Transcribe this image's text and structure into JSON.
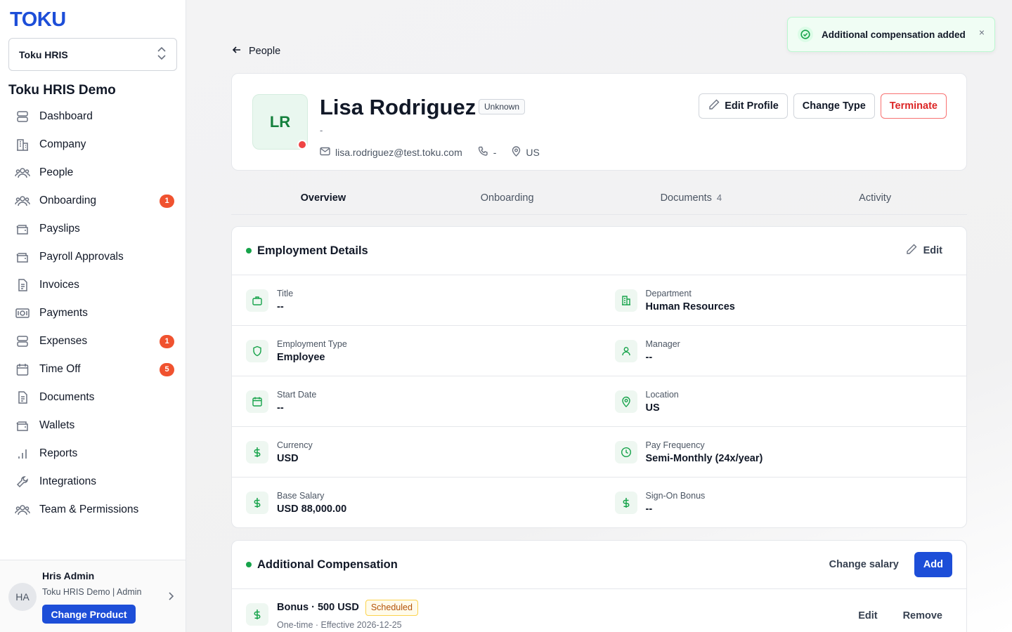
{
  "sidebar": {
    "logo": "TOKU",
    "product_select": "Toku HRIS",
    "org_name": "Toku HRIS Demo",
    "items": [
      {
        "label": "Dashboard",
        "icon": "stack-icon",
        "badge": ""
      },
      {
        "label": "Company",
        "icon": "building-icon",
        "badge": ""
      },
      {
        "label": "People",
        "icon": "users-icon",
        "badge": ""
      },
      {
        "label": "Onboarding",
        "icon": "users-icon",
        "badge": "1"
      },
      {
        "label": "Payslips",
        "icon": "wallet-icon",
        "badge": ""
      },
      {
        "label": "Payroll Approvals",
        "icon": "wallet-icon",
        "badge": ""
      },
      {
        "label": "Invoices",
        "icon": "document-icon",
        "badge": ""
      },
      {
        "label": "Payments",
        "icon": "banknote-icon",
        "badge": ""
      },
      {
        "label": "Expenses",
        "icon": "stack-icon",
        "badge": "1"
      },
      {
        "label": "Time Off",
        "icon": "calendar-icon",
        "badge": "5"
      },
      {
        "label": "Documents",
        "icon": "document-icon",
        "badge": ""
      },
      {
        "label": "Wallets",
        "icon": "wallet-icon",
        "badge": ""
      },
      {
        "label": "Reports",
        "icon": "bar-chart-icon",
        "badge": ""
      },
      {
        "label": "Integrations",
        "icon": "wrench-icon",
        "badge": ""
      },
      {
        "label": "Team & Permissions",
        "icon": "users-icon",
        "badge": ""
      }
    ],
    "user": {
      "initials": "HA",
      "name": "Hris Admin",
      "role": "Toku HRIS Demo | Admin",
      "change_product": "Change Product"
    }
  },
  "breadcrumb": {
    "back_label": "People"
  },
  "profile": {
    "initials": "LR",
    "name": "Lisa Rodriguez",
    "status_badge": "Unknown",
    "subtitle": "-",
    "email": "lisa.rodriguez@test.toku.com",
    "phone": "-",
    "location": "US",
    "buttons": {
      "edit": "Edit Profile",
      "change_type": "Change Type",
      "terminate": "Terminate"
    }
  },
  "tabs": [
    {
      "label": "Overview",
      "count": ""
    },
    {
      "label": "Onboarding",
      "count": ""
    },
    {
      "label": "Documents",
      "count": "4"
    },
    {
      "label": "Activity",
      "count": ""
    }
  ],
  "employment": {
    "title": "Employment Details",
    "edit_label": "Edit",
    "rows": [
      [
        {
          "label": "Title",
          "value": "--",
          "icon": "briefcase-icon"
        },
        {
          "label": "Department",
          "value": "Human Resources",
          "icon": "building-icon"
        }
      ],
      [
        {
          "label": "Employment Type",
          "value": "Employee",
          "icon": "shield-icon"
        },
        {
          "label": "Manager",
          "value": "--",
          "icon": "user-icon"
        }
      ],
      [
        {
          "label": "Start Date",
          "value": "--",
          "icon": "calendar-icon"
        },
        {
          "label": "Location",
          "value": "US",
          "icon": "map-pin-icon"
        }
      ],
      [
        {
          "label": "Currency",
          "value": "USD",
          "icon": "dollar-icon"
        },
        {
          "label": "Pay Frequency",
          "value": "Semi-Monthly (24x/year)",
          "icon": "clock-icon"
        }
      ],
      [
        {
          "label": "Base Salary",
          "value": "USD 88,000.00",
          "icon": "dollar-icon"
        },
        {
          "label": "Sign-On Bonus",
          "value": "--",
          "icon": "dollar-icon"
        }
      ]
    ]
  },
  "compensation": {
    "title": "Additional Compensation",
    "change_salary": "Change salary",
    "add": "Add",
    "items": [
      {
        "title": "Bonus · 500 USD",
        "status": "Scheduled",
        "sub": "One-time · Effective 2026-12-25",
        "edit": "Edit",
        "remove": "Remove"
      }
    ]
  },
  "toast": {
    "message": "Additional compensation added",
    "close": "×"
  },
  "colors": {
    "brand": "#1d4ed8",
    "danger": "#dc2626",
    "success": "#16a34a",
    "badge": "#f0522f"
  }
}
